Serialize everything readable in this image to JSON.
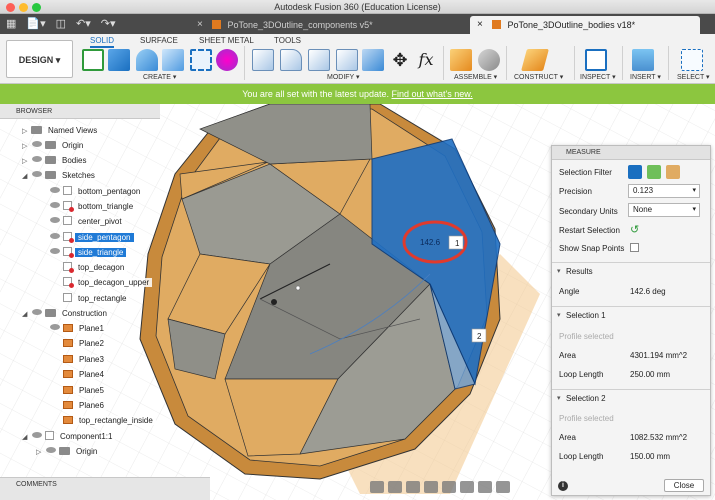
{
  "app": {
    "title": "Autodesk Fusion 360 (Education License)"
  },
  "tabs": [
    {
      "label": "PoTone_3DOutline_components v5*"
    },
    {
      "label": "PoTone_3DOutline_bodies v18*"
    }
  ],
  "toolbar": {
    "workspace": "DESIGN ▾",
    "tabs": [
      "SOLID",
      "SURFACE",
      "SHEET METAL",
      "TOOLS"
    ],
    "groups": [
      "CREATE ▾",
      "MODIFY ▾",
      "ASSEMBLE ▾",
      "CONSTRUCT ▾",
      "INSPECT ▾",
      "INSERT ▾",
      "SELECT ▾"
    ]
  },
  "update_banner": {
    "text": "You are all set with the latest update.",
    "link": "Find out what's new."
  },
  "browser": {
    "title": "BROWSER",
    "items": [
      {
        "label": "Named Views"
      },
      {
        "label": "Origin"
      },
      {
        "label": "Bodies"
      },
      {
        "label": "Sketches"
      },
      {
        "label": "bottom_pentagon"
      },
      {
        "label": "bottom_triangle"
      },
      {
        "label": "center_pivot"
      },
      {
        "label": "side_pentagon"
      },
      {
        "label": "side_triangle"
      },
      {
        "label": "top_decagon"
      },
      {
        "label": "top_decagon_upper"
      },
      {
        "label": "top_rectangle"
      },
      {
        "label": "Construction"
      },
      {
        "label": "Plane1"
      },
      {
        "label": "Plane2"
      },
      {
        "label": "Plane3"
      },
      {
        "label": "Plane4"
      },
      {
        "label": "Plane5"
      },
      {
        "label": "Plane6"
      },
      {
        "label": "top_rectangle_inside"
      },
      {
        "label": "Component1:1"
      },
      {
        "label": "Origin"
      }
    ]
  },
  "comments": {
    "title": "COMMENTS"
  },
  "viewport": {
    "angle_label": "142.6",
    "marker1": "1",
    "marker2": "2"
  },
  "measure": {
    "title": "MEASURE",
    "selection_filter_label": "Selection Filter",
    "precision_label": "Precision",
    "precision_value": "0.123",
    "secondary_units_label": "Secondary Units",
    "secondary_units_value": "None",
    "restart_label": "Restart Selection",
    "snap_label": "Show Snap Points",
    "results": {
      "title": "Results",
      "angle_label": "Angle",
      "angle_value": "142.6 deg"
    },
    "selection1": {
      "title": "Selection 1",
      "subtitle": "Profile selected",
      "area_label": "Area",
      "area_value": "4301.194 mm^2",
      "loop_label": "Loop Length",
      "loop_value": "250.00 mm"
    },
    "selection2": {
      "title": "Selection 2",
      "subtitle": "Profile selected",
      "area_label": "Area",
      "area_value": "1082.532 mm^2",
      "loop_label": "Loop Length",
      "loop_value": "150.00 mm"
    },
    "close_label": "Close"
  },
  "colors": {
    "accent": "#1a6fc0",
    "update_green": "#8cc63f",
    "selection_blue": "#1f6fc4",
    "wood": "#d9a055"
  }
}
